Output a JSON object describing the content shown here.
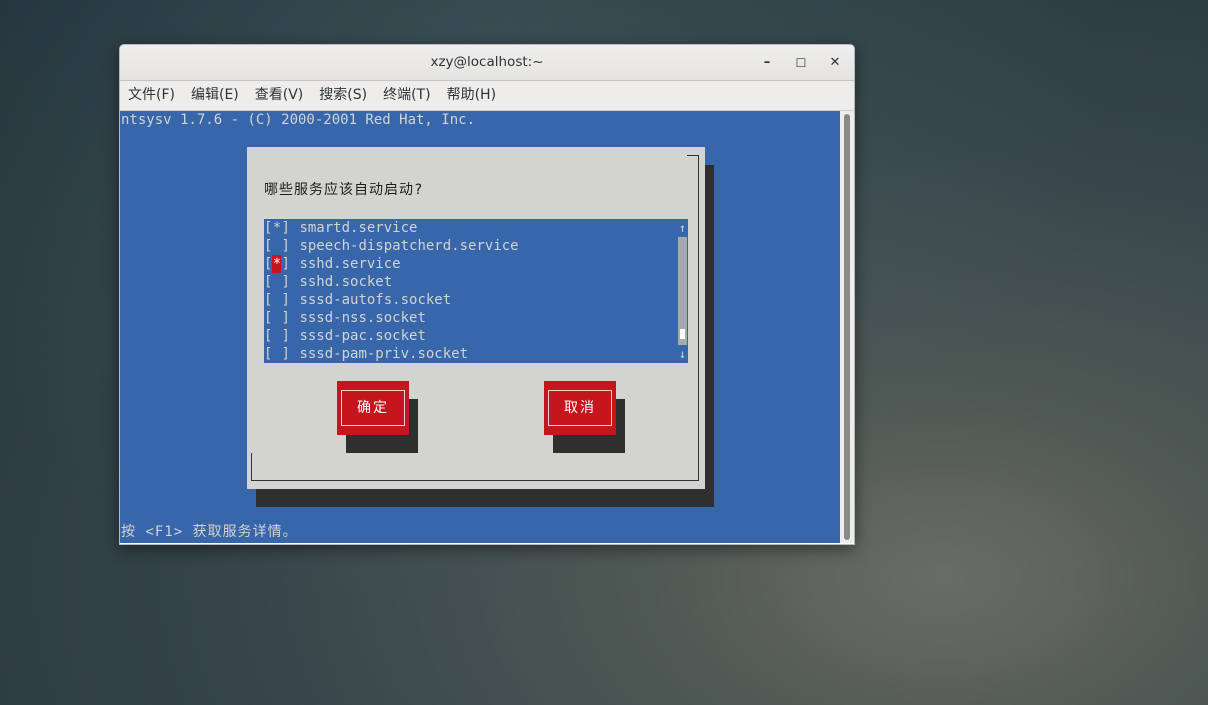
{
  "window": {
    "title": "xzy@localhost:~",
    "minimize_glyph": "–",
    "maximize_glyph": "☐",
    "close_glyph": "✕"
  },
  "menu": {
    "items": [
      {
        "label": "文件(F)"
      },
      {
        "label": "编辑(E)"
      },
      {
        "label": "查看(V)"
      },
      {
        "label": "搜索(S)"
      },
      {
        "label": "终端(T)"
      },
      {
        "label": "帮助(H)"
      }
    ]
  },
  "terminal": {
    "header_line": "ntsysv 1.7.6 - (C) 2000-2001 Red Hat, Inc.",
    "footer_line": "按 <F1> 获取服务详情。",
    "background_color": "#3766aa"
  },
  "dialog": {
    "question": "哪些服务应该自动启动?",
    "services": [
      {
        "mark": "*",
        "name": "smartd.service",
        "focused": false
      },
      {
        "mark": " ",
        "name": "speech-dispatcherd.service",
        "focused": false
      },
      {
        "mark": "*",
        "name": "sshd.service",
        "focused": true
      },
      {
        "mark": " ",
        "name": "sshd.socket",
        "focused": false
      },
      {
        "mark": " ",
        "name": "sssd-autofs.socket",
        "focused": false
      },
      {
        "mark": " ",
        "name": "sssd-nss.socket",
        "focused": false
      },
      {
        "mark": " ",
        "name": "sssd-pac.socket",
        "focused": false
      },
      {
        "mark": " ",
        "name": "sssd-pam-priv.socket",
        "focused": false
      }
    ],
    "scroll_up_glyph": "↑",
    "scroll_down_glyph": "↓",
    "ok_label": "确定",
    "cancel_label": "取消",
    "button_color": "#c4161c"
  }
}
